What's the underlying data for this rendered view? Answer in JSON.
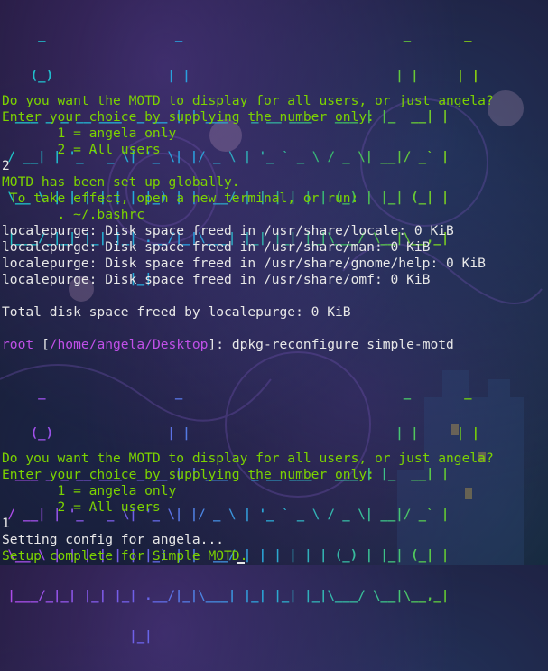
{
  "banner_1": {
    "art": [
      "     _                 _                             _       _",
      "    (_)               | |                           | |     | |",
      "  ___ _ _ __ ___  _ __ | | ___   _ __ ___   ___ | |_  __| |",
      " / __| | '_ ` _ \\| '_ \\| |/ _ \\ | '_ ` _ \\ / _ \\| __|/ _` |",
      " \\__ \\ | | | | | | |_) | |  __/ | | | | | | (_) | |_| (_| |",
      " |___/_|_| |_| |_| .__/|_|\\___| |_| |_| |_|\\___/ \\__|\\__,_|",
      "                 |_|"
    ]
  },
  "session_1": {
    "prompt_question": "Do you want the MOTD to display for all users, or just angela?",
    "prompt_instruction": "Enter your choice by supplying the number only:",
    "option_1": "       1 = angela only",
    "option_2": "       2 = All users",
    "user_input": "2",
    "result_line_1": "MOTD has been set up globally.",
    "result_line_2": " To take effect, open a new terminal, or run:",
    "result_line_3": "       . ~/.bashrc"
  },
  "localepurge": {
    "lines": [
      "localepurge: Disk space freed in /usr/share/locale: 0 KiB",
      "localepurge: Disk space freed in /usr/share/man: 0 KiB",
      "localepurge: Disk space freed in /usr/share/gnome/help: 0 KiB",
      "localepurge: Disk space freed in /usr/share/omf: 0 KiB"
    ],
    "total": "Total disk space freed by localepurge: 0 KiB"
  },
  "shell_prompt": {
    "user": "root",
    "open_bracket": " [",
    "cwd": "/home/angela/Desktop",
    "close": "]: ",
    "command": "dpkg-reconfigure simple-motd"
  },
  "banner_2": {
    "art": [
      "     _                 _                             _       _",
      "    (_)               | |                           | |     | |",
      "  ___ _ _ __ ___  _ __ | | ___   _ __ ___   ___ | |_  __| |",
      " / __| | '_ ` _ \\| '_ \\| |/ _ \\ | '_ ` _ \\ / _ \\| __|/ _` |",
      " \\__ \\ | | | | | | |_) | |  __/ | | | | | | (_) | |_| (_| |",
      " |___/_|_| |_| |_| .__/|_|\\___| |_| |_| |_|\\___/ \\__|\\__,_|",
      "                 |_|"
    ]
  },
  "session_2": {
    "prompt_question": "Do you want the MOTD to display for all users, or just angela?",
    "prompt_instruction": "Enter your choice by supplying the number only:",
    "option_1": "       1 = angela only",
    "option_2": "       2 = All users",
    "user_input": "1",
    "result_line_1": "Setting config for angela...",
    "result_line_2": "Setup complete for Simple MOTD."
  },
  "colors": {
    "green": "#7cd300",
    "white": "#e8e8e8",
    "purple": "#c050e8"
  }
}
